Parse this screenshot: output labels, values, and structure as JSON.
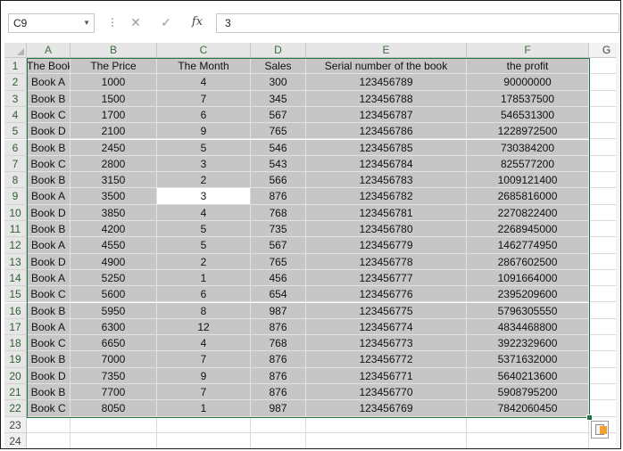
{
  "namebox": {
    "value": "C9"
  },
  "formula_bar": {
    "cancel_icon": "close-icon",
    "enter_icon": "check-icon",
    "fx_label": "fx",
    "value": "3"
  },
  "columns": [
    "A",
    "B",
    "C",
    "D",
    "E",
    "F",
    "G"
  ],
  "row_numbers": [
    "1",
    "2",
    "3",
    "4",
    "5",
    "6",
    "7",
    "8",
    "9",
    "10",
    "11",
    "12",
    "13",
    "14",
    "15",
    "16",
    "17",
    "18",
    "19",
    "20",
    "21",
    "22",
    "23",
    "24"
  ],
  "rows": [
    [
      "The Book",
      "The Price",
      "The Month",
      "Sales",
      "Serial number of the book",
      "the profit"
    ],
    [
      "Book A",
      "1000",
      "4",
      "300",
      "123456789",
      "90000000"
    ],
    [
      "Book B",
      "1500",
      "7",
      "345",
      "123456788",
      "178537500"
    ],
    [
      "Book C",
      "1700",
      "6",
      "567",
      "123456787",
      "546531300"
    ],
    [
      "Book D",
      "2100",
      "9",
      "765",
      "123456786",
      "1228972500"
    ],
    [
      "Book B",
      "2450",
      "5",
      "546",
      "123456785",
      "730384200"
    ],
    [
      "Book C",
      "2800",
      "3",
      "543",
      "123456784",
      "825577200"
    ],
    [
      "Book B",
      "3150",
      "2",
      "566",
      "123456783",
      "1009121400"
    ],
    [
      "Book A",
      "3500",
      "3",
      "876",
      "123456782",
      "2685816000"
    ],
    [
      "Book D",
      "3850",
      "4",
      "768",
      "123456781",
      "2270822400"
    ],
    [
      "Book B",
      "4200",
      "5",
      "735",
      "123456780",
      "2268945000"
    ],
    [
      "Book A",
      "4550",
      "5",
      "567",
      "123456779",
      "1462774950"
    ],
    [
      "Book D",
      "4900",
      "2",
      "765",
      "123456778",
      "2867602500"
    ],
    [
      "Book A",
      "5250",
      "1",
      "456",
      "123456777",
      "1091664000"
    ],
    [
      "Book C",
      "5600",
      "6",
      "654",
      "123456776",
      "2395209600"
    ],
    [
      "Book B",
      "5950",
      "8",
      "987",
      "123456775",
      "5796305550"
    ],
    [
      "Book A",
      "6300",
      "12",
      "876",
      "123456774",
      "4834468800"
    ],
    [
      "Book C",
      "6650",
      "4",
      "768",
      "123456773",
      "3922329600"
    ],
    [
      "Book B",
      "7000",
      "7",
      "876",
      "123456772",
      "5371632000"
    ],
    [
      "Book D",
      "7350",
      "9",
      "876",
      "123456771",
      "5640213600"
    ],
    [
      "Book B",
      "7700",
      "7",
      "876",
      "123456770",
      "5908795200"
    ],
    [
      "Book C",
      "8050",
      "1",
      "987",
      "123456769",
      "7842060450"
    ]
  ],
  "colors": {
    "selection_fill": "#c6c6c6",
    "selection_border": "#217346",
    "header_bg": "#e6e6e6"
  },
  "quick_analysis_icon": "quick-analysis-icon"
}
